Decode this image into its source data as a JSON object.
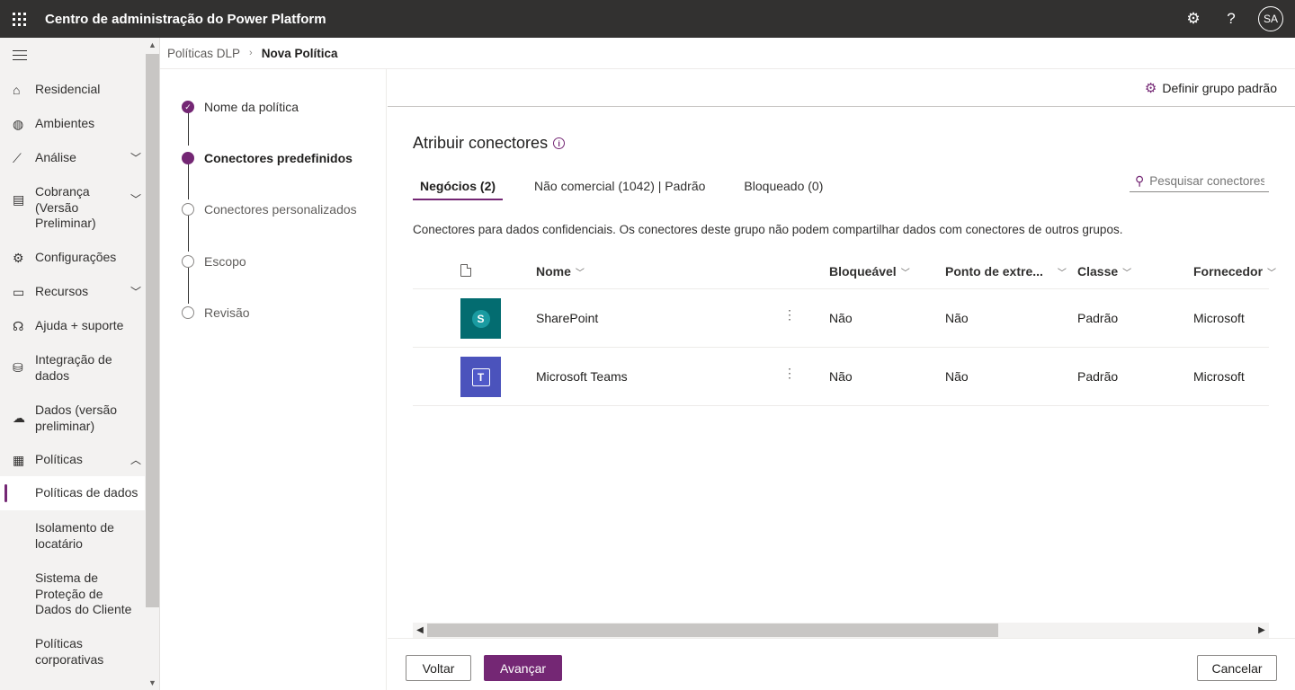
{
  "app": {
    "title": "Centro de administração do Power Platform",
    "avatar_initials": "SA"
  },
  "colors": {
    "accent": "#742774",
    "topbar": "#323130"
  },
  "leftnav": {
    "items": [
      {
        "label": "Residencial",
        "icon": "home-icon"
      },
      {
        "label": "Ambientes",
        "icon": "globe-icon"
      },
      {
        "label": "Análise",
        "icon": "chart-icon"
      },
      {
        "label": "Cobrança (Versão Preliminar)",
        "icon": "billing-icon"
      },
      {
        "label": "Configurações",
        "icon": "gear-icon"
      },
      {
        "label": "Recursos",
        "icon": "resources-icon"
      },
      {
        "label": "Ajuda + suporte",
        "icon": "headset-icon"
      },
      {
        "label": "Integração de dados",
        "icon": "data-integration-icon"
      },
      {
        "label": "Dados (versão preliminar)",
        "icon": "cloud-icon"
      },
      {
        "label": "Políticas",
        "icon": "policy-icon"
      },
      {
        "label": "Políticas de dados"
      },
      {
        "label": "Isolamento de locatário"
      },
      {
        "label": "Sistema de Proteção de Dados do Cliente"
      },
      {
        "label": "Políticas corporativas"
      }
    ]
  },
  "breadcrumb": {
    "parent": "Políticas DLP",
    "current": "Nova Política"
  },
  "stepper": {
    "steps": [
      {
        "label": "Nome da política",
        "state": "done"
      },
      {
        "label": "Conectores predefinidos",
        "state": "current"
      },
      {
        "label": "Conectores personalizados",
        "state": "pending"
      },
      {
        "label": "Escopo",
        "state": "pending"
      },
      {
        "label": "Revisão",
        "state": "pending"
      }
    ]
  },
  "main": {
    "command": "Definir grupo padrão",
    "title": "Atribuir conectores",
    "tabs": [
      {
        "label": "Negócios (2)"
      },
      {
        "label": "Não comercial (1042) | Padrão"
      },
      {
        "label": "Bloqueado (0)"
      }
    ],
    "search_placeholder": "Pesquisar conectores",
    "description": "Conectores para dados confidenciais. Os conectores deste grupo não podem compartilhar dados com conectores de outros grupos.",
    "columns": {
      "name": "Nome",
      "blockable": "Bloqueável",
      "endpoint": "Ponto de extre...",
      "class": "Classe",
      "publisher": "Fornecedor"
    },
    "rows": [
      {
        "name": "SharePoint",
        "blockable": "Não",
        "endpoint": "Não",
        "class": "Padrão",
        "publisher": "Microsoft",
        "icon_letter": "S"
      },
      {
        "name": "Microsoft Teams",
        "blockable": "Não",
        "endpoint": "Não",
        "class": "Padrão",
        "publisher": "Microsoft",
        "icon_letter": "T"
      }
    ]
  },
  "footer": {
    "back": "Voltar",
    "next": "Avançar",
    "cancel": "Cancelar"
  }
}
